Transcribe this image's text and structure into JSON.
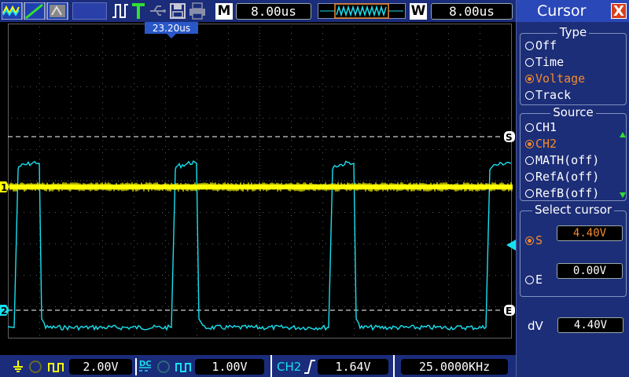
{
  "toolbar": {
    "mode_letter": "M",
    "timebase": "8.00us",
    "window_letter": "W",
    "window_timebase": "8.00us",
    "trigger_position": "23.20us"
  },
  "markers": {
    "ch1": "1",
    "ch2": "2",
    "cursor_s": "S",
    "cursor_e": "E"
  },
  "bottom": {
    "ch1_scale": "2.00V",
    "ch2_scale": "1.00V",
    "trigger_source": "CH2",
    "trigger_level": "1.64V",
    "frequency": "25.0000KHz"
  },
  "menu": {
    "title": "Cursor",
    "close": "X",
    "type": {
      "title": "Type",
      "options": [
        "Off",
        "Time",
        "Voltage",
        "Track"
      ],
      "selected": "Voltage"
    },
    "source": {
      "title": "Source",
      "options": [
        "CH1",
        "CH2",
        "MATH(off)",
        "RefA(off)",
        "RefB(off)"
      ],
      "selected": "CH2"
    },
    "select_cursor": {
      "title": "Select cursor",
      "s_label": "S",
      "s_value": "4.40V",
      "e_label": "E",
      "e_value": "0.00V",
      "selected": "S"
    },
    "dv_label": "dV",
    "dv_value": "4.40V"
  },
  "colors": {
    "ch1": "#ffff00",
    "ch2": "#19e0ee",
    "selected": "#f08a2c",
    "panel": "#1d2e78",
    "bar": "#1a2c7a"
  },
  "icons": {
    "run": "square-wave-run-icon",
    "trigger": "trigger-T-icon",
    "usb": "usb-icon",
    "save": "floppy-save-icon",
    "print": "printer-icon"
  }
}
